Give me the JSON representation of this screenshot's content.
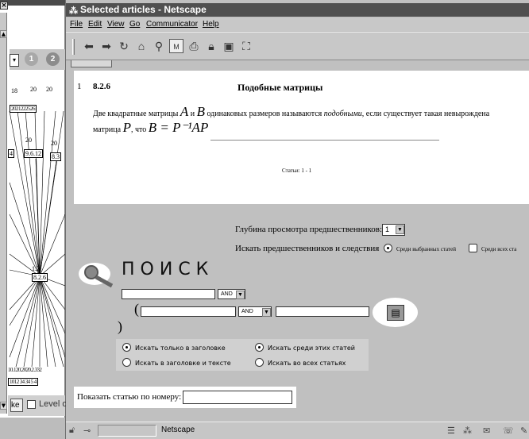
{
  "background_window": {
    "close_label": "×",
    "toolbar": {
      "select_value": "",
      "circle1": "1",
      "circle2": "2"
    },
    "graph": {
      "top_labels": [
        "18",
        "20",
        "20"
      ],
      "top_cluster": "2021222526",
      "mid_labels": [
        "20",
        "20"
      ],
      "mid_nodes": [
        "4",
        "9.6.12",
        "8.3"
      ],
      "center_node": "8.2.6",
      "center_label": "1.2",
      "bottom_labels": "10.120.2020.2.332",
      "bottom_cluster": "1012 34 34 5 4"
    },
    "bottom": {
      "button_label": "ke",
      "level_label": "Level o"
    }
  },
  "window": {
    "title": "Selected articles - Netscape",
    "title_icon": "⁂",
    "menu": [
      "File",
      "Edit",
      "View",
      "Go",
      "Communicator",
      "Help"
    ],
    "toolbar_icons": [
      "back-icon",
      "forward-icon",
      "reload-icon",
      "home-icon",
      "search-icon",
      "guide-icon",
      "print-icon",
      "security-icon",
      "shop-icon",
      "stop-icon"
    ]
  },
  "article": {
    "number": "1",
    "section": "8.2.6",
    "title": "Подобные матрицы",
    "def_line1_pre": "Две квадратные матрицы",
    "def_A": "A",
    "def_and": "и",
    "def_B": "B",
    "def_line1_mid": "одинаковых размеров называются",
    "def_italic": "подобными,",
    "def_line1_post": "если существует такая невырождена",
    "def_line2_pre": "матрица",
    "def_P": "P",
    "def_line2_mid": ", что",
    "def_formula": "B = P⁻¹AP",
    "articles_count": "Статьи: 1 - 1"
  },
  "controls": {
    "depth_label": "Глубина просмотра предшественников:",
    "depth_value": "1",
    "seek_label": "Искать предшественников и следствия",
    "seek_opt1": "Среди выбранных статей",
    "seek_opt2": "Среди всех ста"
  },
  "search": {
    "title": "ПОИСК",
    "and1": "AND",
    "and2": "AND",
    "open_paren": "(",
    "close_paren": ")",
    "opt_title_only": "Искать только в заголовке",
    "opt_title_text": "Искать в заголовке и тексте",
    "opt_these": "Искать среди этих статей",
    "opt_all": "Искать во всех статьях",
    "show_label": "Показать статью по номеру:"
  },
  "status": {
    "text": "Netscape"
  }
}
